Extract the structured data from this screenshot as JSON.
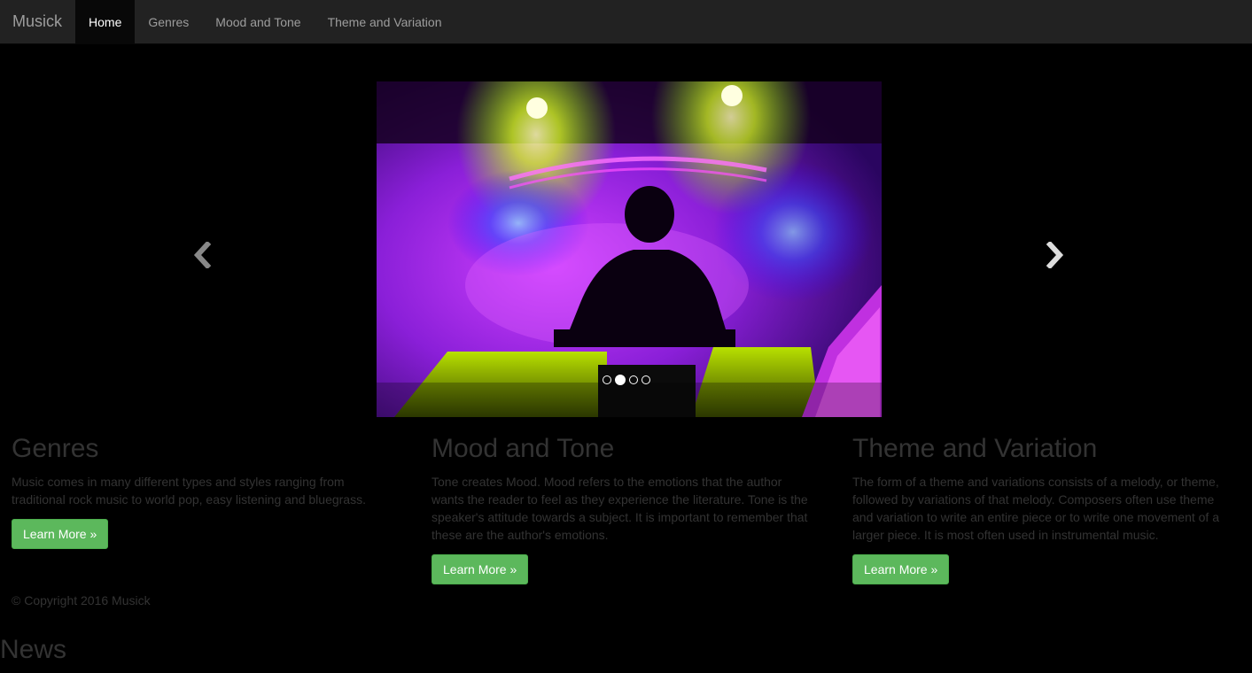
{
  "nav": {
    "brand": "Musick",
    "items": [
      {
        "label": "Home",
        "active": true
      },
      {
        "label": "Genres",
        "active": false
      },
      {
        "label": "Mood and Tone",
        "active": false
      },
      {
        "label": "Theme and Variation",
        "active": false
      }
    ]
  },
  "carousel": {
    "image_icon": "dj-concert-photo",
    "prev_icon": "chevron-left-icon",
    "next_icon": "chevron-right-icon",
    "slide_count": 4,
    "active_slide": 2
  },
  "columns": [
    {
      "title": "Genres",
      "text": "Music comes in many different types and styles ranging from traditional rock music to world pop, easy listening and bluegrass.",
      "button": "Learn More »"
    },
    {
      "title": "Mood and Tone",
      "text": "Tone creates Mood. Mood refers to the emotions that the author wants the reader to feel as they experience the literature. Tone is the speaker's attitude towards a subject. It is important to remember that these are the author's emotions.",
      "button": "Learn More »"
    },
    {
      "title": "Theme and Variation",
      "text": "The form of a theme and variations consists of a melody, or theme, followed by variations of that melody. Composers often use theme and variation to write an entire piece or to write one movement of a larger piece. It is most often used in instrumental music.",
      "button": "Learn More »"
    }
  ],
  "footer": {
    "copyright": "© Copyright 2016 Musick"
  },
  "news": {
    "heading": "News"
  },
  "colors": {
    "navbar_bg": "#222222",
    "accent_green": "#5cb85c",
    "page_bg": "#000000",
    "muted_text": "#333333"
  }
}
